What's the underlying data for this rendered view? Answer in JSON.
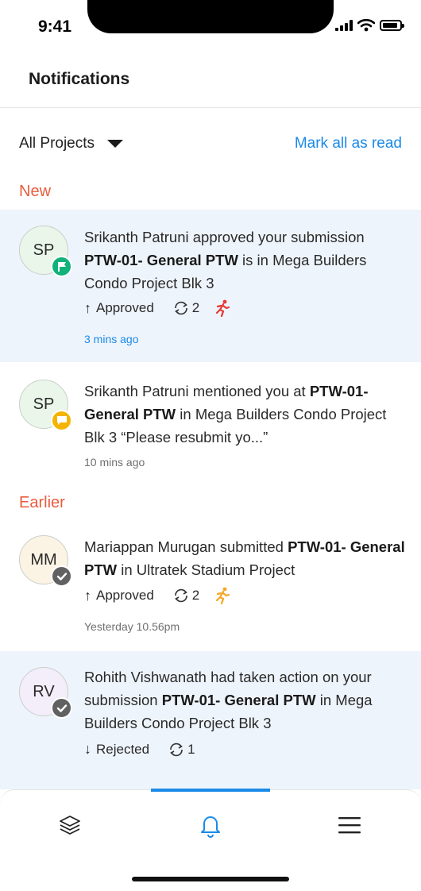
{
  "status_bar": {
    "time": "9:41"
  },
  "header": {
    "title": "Notifications"
  },
  "filter": {
    "project_label": "All Projects",
    "mark_all_label": "Mark all as read"
  },
  "sections": {
    "new_label": "New",
    "earlier_label": "Earlier"
  },
  "notifications": [
    {
      "initials": "SP",
      "badge_icon": "flag-icon",
      "text_pre": "Srikanth Patruni approved your submission ",
      "text_bold": "PTW-01- General PTW",
      "text_post": " is in Mega Builders Condo Project Blk 3",
      "status": "Approved",
      "cycle_count": "2",
      "runner_color": "#e53935",
      "time": "3 mins ago"
    },
    {
      "initials": "SP",
      "badge_icon": "chat-icon",
      "text_pre": "Srikanth Patruni mentioned you at ",
      "text_bold": "PTW-01- General PTW",
      "text_post": " in Mega Builders Condo Project Blk 3 “Please resubmit yo...”",
      "time": "10 mins ago"
    },
    {
      "initials": "MM",
      "badge_icon": "check-icon",
      "text_pre": "Mariappan Murugan submitted ",
      "text_bold": "PTW-01- General PTW",
      "text_post": " in Ultratek Stadium Project",
      "status": "Approved",
      "cycle_count": "2",
      "runner_color": "#f5a623",
      "time": "Yesterday 10.56pm"
    },
    {
      "initials": "RV",
      "badge_icon": "check-icon",
      "text_pre": "Rohith Vishwanath had taken action on your submission ",
      "text_bold": "PTW-01- General PTW",
      "text_post": " in Mega Builders Condo Project Blk 3",
      "status": "Rejected",
      "cycle_count": "1"
    }
  ],
  "colors": {
    "accent": "#1a8ae8",
    "section_label": "#e85d3f",
    "unread_bg": "#eef4fb"
  },
  "bottom_nav": {
    "items": [
      "layers-icon",
      "bell-icon",
      "menu-icon"
    ],
    "active": "bell-icon"
  }
}
